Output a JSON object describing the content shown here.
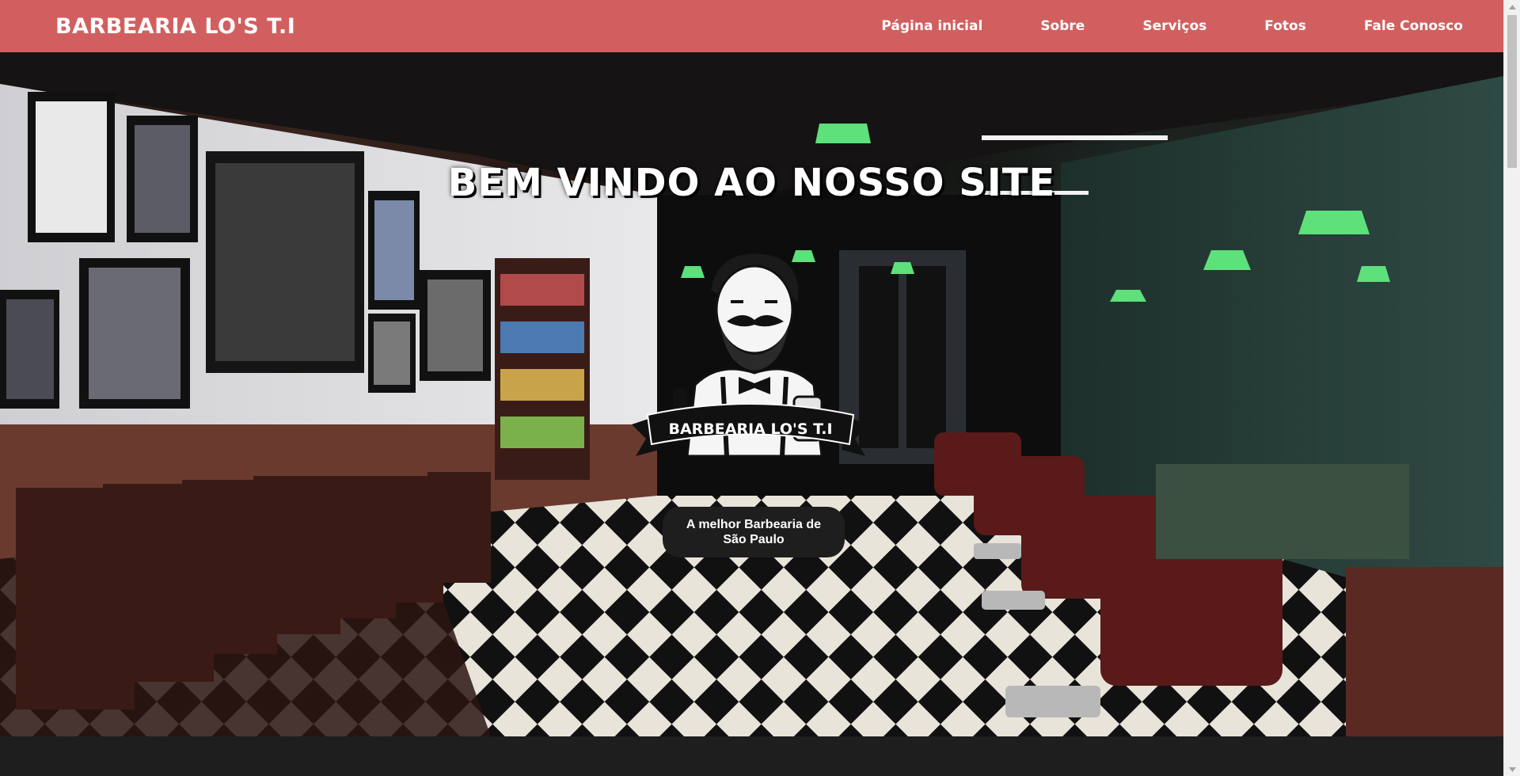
{
  "navbar": {
    "brand": "BARBEARIA LO'S T.I",
    "links": [
      "Página inicial",
      "Sobre",
      "Serviços",
      "Fotos",
      "Fale Conosco"
    ]
  },
  "hero": {
    "title": "BEM VINDO AO NOSSO SITE",
    "logo_text": "BARBEARIA LO'S T.I",
    "tagline": "A melhor Barbearia de São Paulo"
  },
  "icons": {
    "logo": "barber-mascot-icon",
    "scroll_up": "triangle-up-icon",
    "scroll_down": "triangle-down-icon"
  },
  "colors": {
    "navbar": "#d25f5f",
    "tagline_bg": "#1e1e1e",
    "footer": "#1e1e1e"
  }
}
